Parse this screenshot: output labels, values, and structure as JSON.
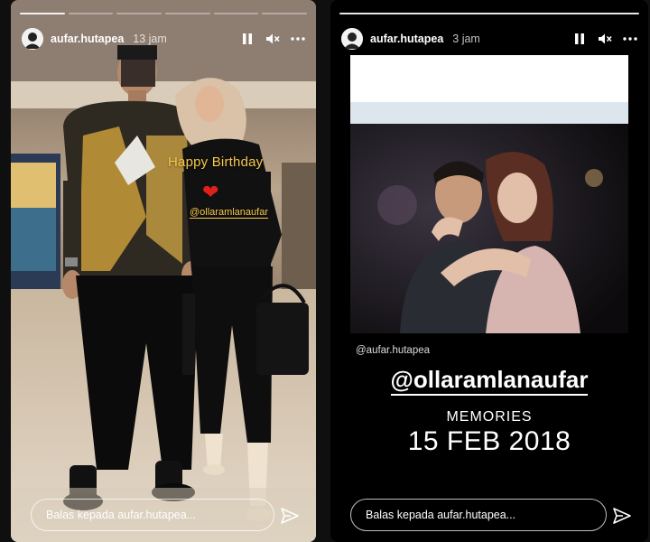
{
  "left_story": {
    "username": "aufar.hutapea",
    "time": "13 jam",
    "sticker_text": "Happy Birthday",
    "mention": "@ollaramlanaufar",
    "reply_placeholder": "Balas kepada aufar.hutapea...",
    "progress_segments": 6,
    "progress_done": 1
  },
  "right_story": {
    "username": "aufar.hutapea",
    "time": "3 jam",
    "repost_credit": "@aufar.hutapea",
    "mention": "@ollaramlanaufar",
    "memories_label": "MEMORIES",
    "date": "15 FEB 2018",
    "reply_placeholder": "Balas kepada aufar.hutapea..."
  },
  "icons": {
    "pause": "pause-icon",
    "mute": "speaker-muted-icon",
    "more": "more-options-icon",
    "send": "send-icon"
  },
  "colors": {
    "sticker_yellow": "#f6c84a",
    "heart_red": "#e0211b"
  }
}
